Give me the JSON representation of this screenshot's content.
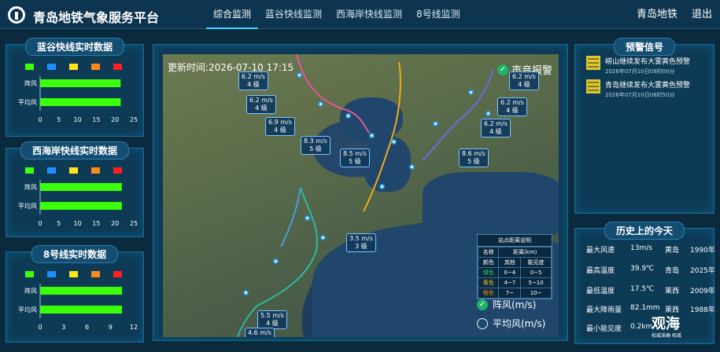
{
  "header": {
    "title": "青岛地铁气象服务平台",
    "tabs": [
      "综合监测",
      "蓝谷快线监测",
      "西海岸快线监测",
      "8号线监测"
    ],
    "active_tab": 0,
    "right_links": [
      "青岛地铁",
      "退出"
    ]
  },
  "colors": {
    "bar_green": "#3cff0a",
    "legend": [
      "#3cff0a",
      "#1e8fff",
      "#ffe51a",
      "#ff8a1a",
      "#ff1e1e"
    ]
  },
  "left_panels": [
    {
      "title": "蓝谷快线实时数据",
      "rows": [
        "阵风",
        "平均风"
      ],
      "chart_data": {
        "type": "bar",
        "orientation": "horizontal",
        "categories": [
          "阵风",
          "平均风"
        ],
        "values": [
          21.5,
          21.5
        ],
        "xlim": [
          0,
          25
        ],
        "ticks": [
          "0",
          "5",
          "10",
          "15",
          "20",
          "25"
        ]
      }
    },
    {
      "title": "西海岸快线实时数据",
      "rows": [
        "阵风",
        "平均风"
      ],
      "chart_data": {
        "type": "bar",
        "orientation": "horizontal",
        "categories": [
          "阵风",
          "平均风"
        ],
        "values": [
          21.8,
          21.8
        ],
        "xlim": [
          0,
          25
        ],
        "ticks": [
          "0",
          "5",
          "10",
          "15",
          "20",
          "25"
        ]
      }
    },
    {
      "title": "8号线实时数据",
      "rows": [
        "阵风",
        "平均风"
      ],
      "chart_data": {
        "type": "bar",
        "orientation": "horizontal",
        "categories": [
          "阵风",
          "平均风"
        ],
        "values": [
          10.5,
          10.5
        ],
        "xlim": [
          0,
          12
        ],
        "ticks": [
          "0",
          "3",
          "6",
          "9",
          "12"
        ]
      }
    }
  ],
  "map": {
    "update_time": "更新时间:2026-07-10 17:15",
    "sound_alarm": "声音报警",
    "tags": [
      {
        "speed": "6.2 m/s",
        "grade": "4 级"
      },
      {
        "speed": "6.2 m/s",
        "grade": "4 级"
      },
      {
        "speed": "6.9 m/s",
        "grade": "4 级"
      },
      {
        "speed": "8.3 m/s",
        "grade": "5 级"
      },
      {
        "speed": "8.5 m/s",
        "grade": "5 级"
      },
      {
        "speed": "6.2 m/s",
        "grade": "4 级"
      },
      {
        "speed": "6.2 m/s",
        "grade": "4 级"
      },
      {
        "speed": "6.2 m/s",
        "grade": "4 级"
      },
      {
        "speed": "8.6 m/s",
        "grade": "5 级"
      },
      {
        "speed": "3.5 m/s",
        "grade": "3 级"
      },
      {
        "speed": "5.5 m/s",
        "grade": "4 级"
      },
      {
        "speed": "4.6 m/s",
        "grade": ""
      }
    ],
    "distance_legend": {
      "title": "站点距离说明",
      "headers": [
        "名称",
        "距离(km)"
      ],
      "sub_headers": [
        "颜色",
        "其他",
        "能见度"
      ],
      "rows": [
        {
          "name": "绿色",
          "other": "0~4",
          "vis": "0~5",
          "color": "#36d16a"
        },
        {
          "name": "黄色",
          "other": "4~7",
          "vis": "5~10",
          "color": "#f2c21a"
        },
        {
          "name": "橙色",
          "other": "7~",
          "vis": "10~",
          "color": "#ff8a1a"
        }
      ]
    },
    "options": [
      "阵风(m/s)",
      "平均风(m/s)"
    ]
  },
  "alerts": {
    "title": "预警信号",
    "items": [
      {
        "title": "崂山继续发布大雾黄色预警",
        "time": "2026年07月10日09时00分"
      },
      {
        "title": "青岛继续发布大雾黄色预警",
        "time": "2026年07月10日08时50分"
      }
    ]
  },
  "history": {
    "title": "历史上的今天",
    "rows": [
      [
        "最大风速",
        "13m/s",
        "黄岛",
        "1990年"
      ],
      [
        "最高温度",
        "39.9℃",
        "青岛",
        "2025年"
      ],
      [
        "最低温度",
        "17.5℃",
        "莱西",
        "2009年"
      ],
      [
        "最大降雨量",
        "82.1mm",
        "莱西",
        "1988年"
      ],
      [
        "最小能见度",
        "0.2km",
        "",
        ""
      ]
    ]
  },
  "watermark": {
    "brand": "观海",
    "sub": "权威准确 权威"
  }
}
